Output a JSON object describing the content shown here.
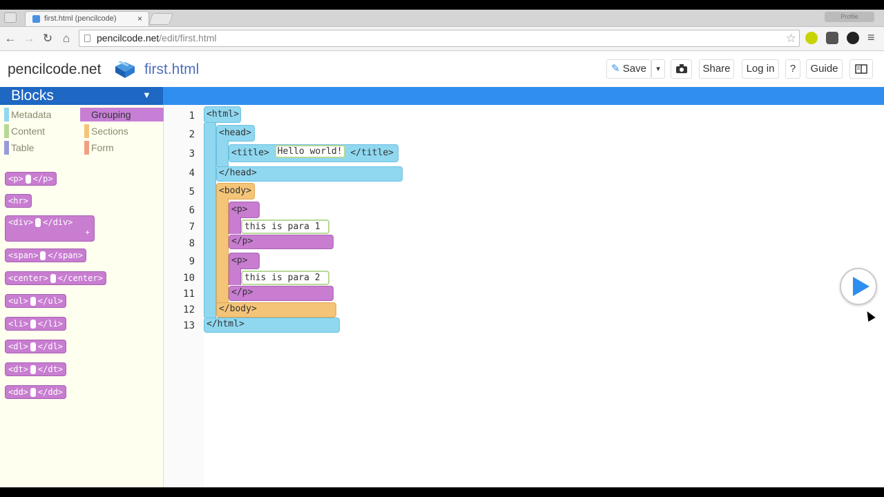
{
  "browser": {
    "tab_title": "first.html (pencilcode)",
    "tab_close": "×",
    "url_host": "pencilcode.net",
    "url_path": "/edit/first.html",
    "profile": "Profile"
  },
  "header": {
    "brand": "pencilcode.net",
    "filename": "first.html",
    "save_label": "Save",
    "save_dropdown": "▾",
    "share_label": "Share",
    "login_label": "Log in",
    "help_label": "?",
    "guide_label": "Guide"
  },
  "palette": {
    "title": "Blocks",
    "title_arrow": "▼",
    "categories": [
      {
        "label": "Metadata",
        "color": "#8fd8f0"
      },
      {
        "label": "Grouping",
        "color": "#c87dd1"
      },
      {
        "label": "Content",
        "color": "#b6d896"
      },
      {
        "label": "Sections",
        "color": "#f4c478"
      },
      {
        "label": "Table",
        "color": "#9a9ad8"
      },
      {
        "label": "Form",
        "color": "#f0a080"
      }
    ],
    "blocks": [
      {
        "open": "<p>",
        "close": "</p>"
      },
      {
        "open": "<hr>",
        "close": ""
      },
      {
        "open": "<div>",
        "close": "</div>"
      },
      {
        "open": "<span>",
        "close": "</span>"
      },
      {
        "open": "<center>",
        "close": "</center>"
      },
      {
        "open": "<ul>",
        "close": "</ul>"
      },
      {
        "open": "<li>",
        "close": "</li>"
      },
      {
        "open": "<dl>",
        "close": "</dl>"
      },
      {
        "open": "<dt>",
        "close": "</dt>"
      },
      {
        "open": "<dd>",
        "close": "</dd>"
      }
    ],
    "div_plus": "+"
  },
  "editor": {
    "line_numbers": [
      "1",
      "2",
      "3",
      "4",
      "5",
      "6",
      "7",
      "8",
      "9",
      "10",
      "11",
      "12",
      "13"
    ],
    "html_open": "<html>",
    "head_open": "<head>",
    "title_open": "<title>",
    "title_text": "Hello world!",
    "title_close": "</title>",
    "head_close": "</head>",
    "body_open": "<body>",
    "p1_open": "<p>",
    "p1_text": "this is para 1",
    "p1_close": "</p>",
    "p2_open": "<p>",
    "p2_text": "this is para 2",
    "p2_close": "</p>",
    "body_close": "</body>",
    "html_close": "</html>"
  }
}
